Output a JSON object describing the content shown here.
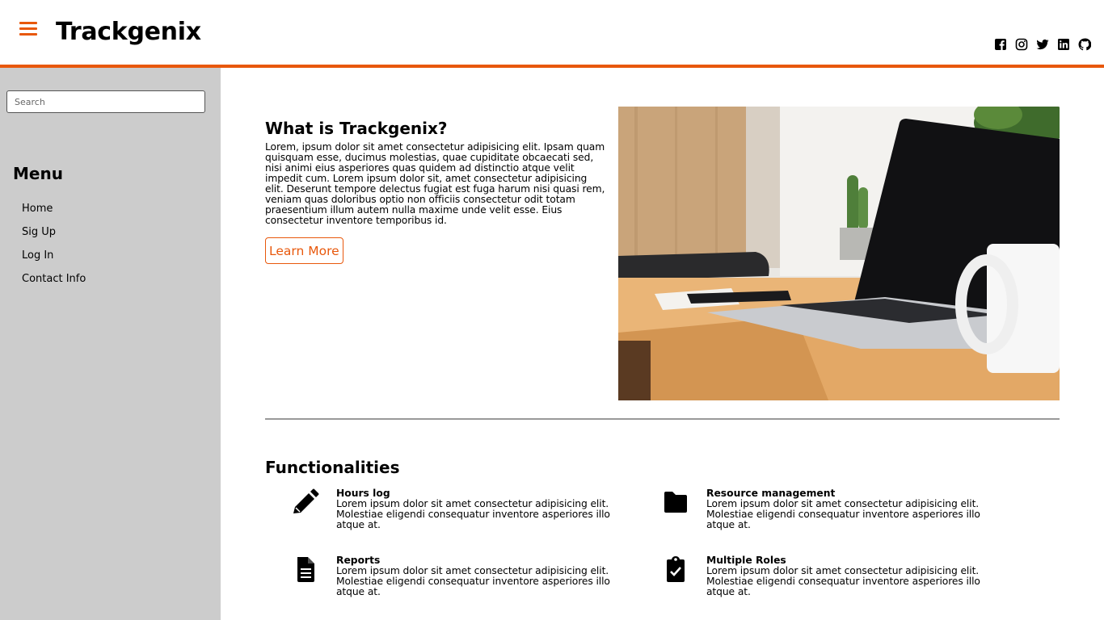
{
  "brand": {
    "title": "Trackgenix",
    "accent_color": "#e8580c"
  },
  "header": {
    "socials": [
      {
        "icon": "facebook-icon"
      },
      {
        "icon": "instagram-icon"
      },
      {
        "icon": "twitter-icon"
      },
      {
        "icon": "linkedin-icon"
      },
      {
        "icon": "github-icon"
      }
    ]
  },
  "sidebar": {
    "search_placeholder": "Search",
    "menu_title": "Menu",
    "items": [
      {
        "label": "Home"
      },
      {
        "label": "Sig Up"
      },
      {
        "label": "Log In"
      },
      {
        "label": "Contact Info"
      }
    ],
    "background": "#cccccc"
  },
  "about": {
    "title": "What is Trackgenix?",
    "text": "Lorem, ipsum dolor sit amet consectetur adipisicing elit. Ipsam quam quisquam esse, ducimus molestias, quae cupiditate obcaecati sed, nisi animi eius asperiores quas quidem ad distinctio atque velit impedit cum. Lorem ipsum dolor sit, amet consectetur adipisicing elit. Deserunt tempore delectus fugiat est fuga harum nisi quasi rem, veniam quas doloribus optio non officiis consectetur odit totam praesentium illum autem nulla maxime unde velit esse. Eius consectetur inventore temporibus id.",
    "button_label": "Learn More",
    "image_icon": "laptop-desk-photo"
  },
  "functionalities": {
    "title": "Functionalities",
    "items": [
      {
        "icon": "pencil-icon",
        "name": "Hours log",
        "desc": "Lorem ipsum dolor sit amet consectetur adipisicing elit. Molestiae eligendi consequatur inventore asperiores illo atque at."
      },
      {
        "icon": "folder-icon",
        "name": "Resource management",
        "desc": "Lorem ipsum dolor sit amet consectetur adipisicing elit. Molestiae eligendi consequatur inventore asperiores illo atque at."
      },
      {
        "icon": "file-icon",
        "name": "Reports",
        "desc": "Lorem ipsum dolor sit amet consectetur adipisicing elit. Molestiae eligendi consequatur inventore asperiores illo atque at."
      },
      {
        "icon": "clipboard-check-icon",
        "name": "Multiple Roles",
        "desc": "Lorem ipsum dolor sit amet consectetur adipisicing elit. Molestiae eligendi consequatur inventore asperiores illo atque at."
      }
    ]
  }
}
